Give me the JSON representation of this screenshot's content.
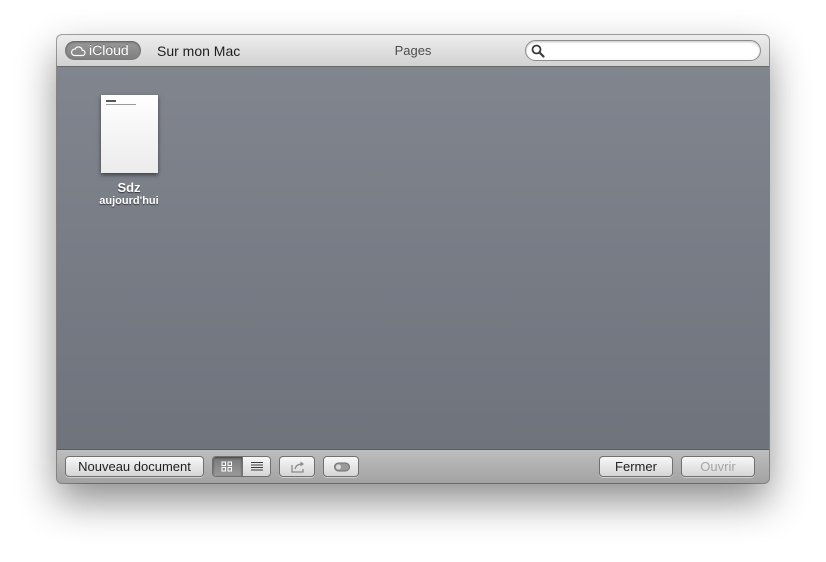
{
  "titlebar": {
    "tabs": [
      "iCloud",
      "Sur mon Mac"
    ],
    "icloud_icon": "cloud-icon",
    "app_title": "Pages",
    "search": {
      "icon": "search-icon",
      "value": "",
      "placeholder": ""
    }
  },
  "documents": [
    {
      "name": "Sdz",
      "date": "aujourd'hui"
    }
  ],
  "bottombar": {
    "new_document_label": "Nouveau document",
    "view_icons": [
      "grid-view-icon",
      "list-view-icon"
    ],
    "share_icon": "share-icon",
    "toggle_icon": "toggle-icon",
    "close_label": "Fermer",
    "open_label": "Ouvrir"
  },
  "colors": {
    "content_background": "#7c8089",
    "disabled_text": "#a4a4a4"
  }
}
